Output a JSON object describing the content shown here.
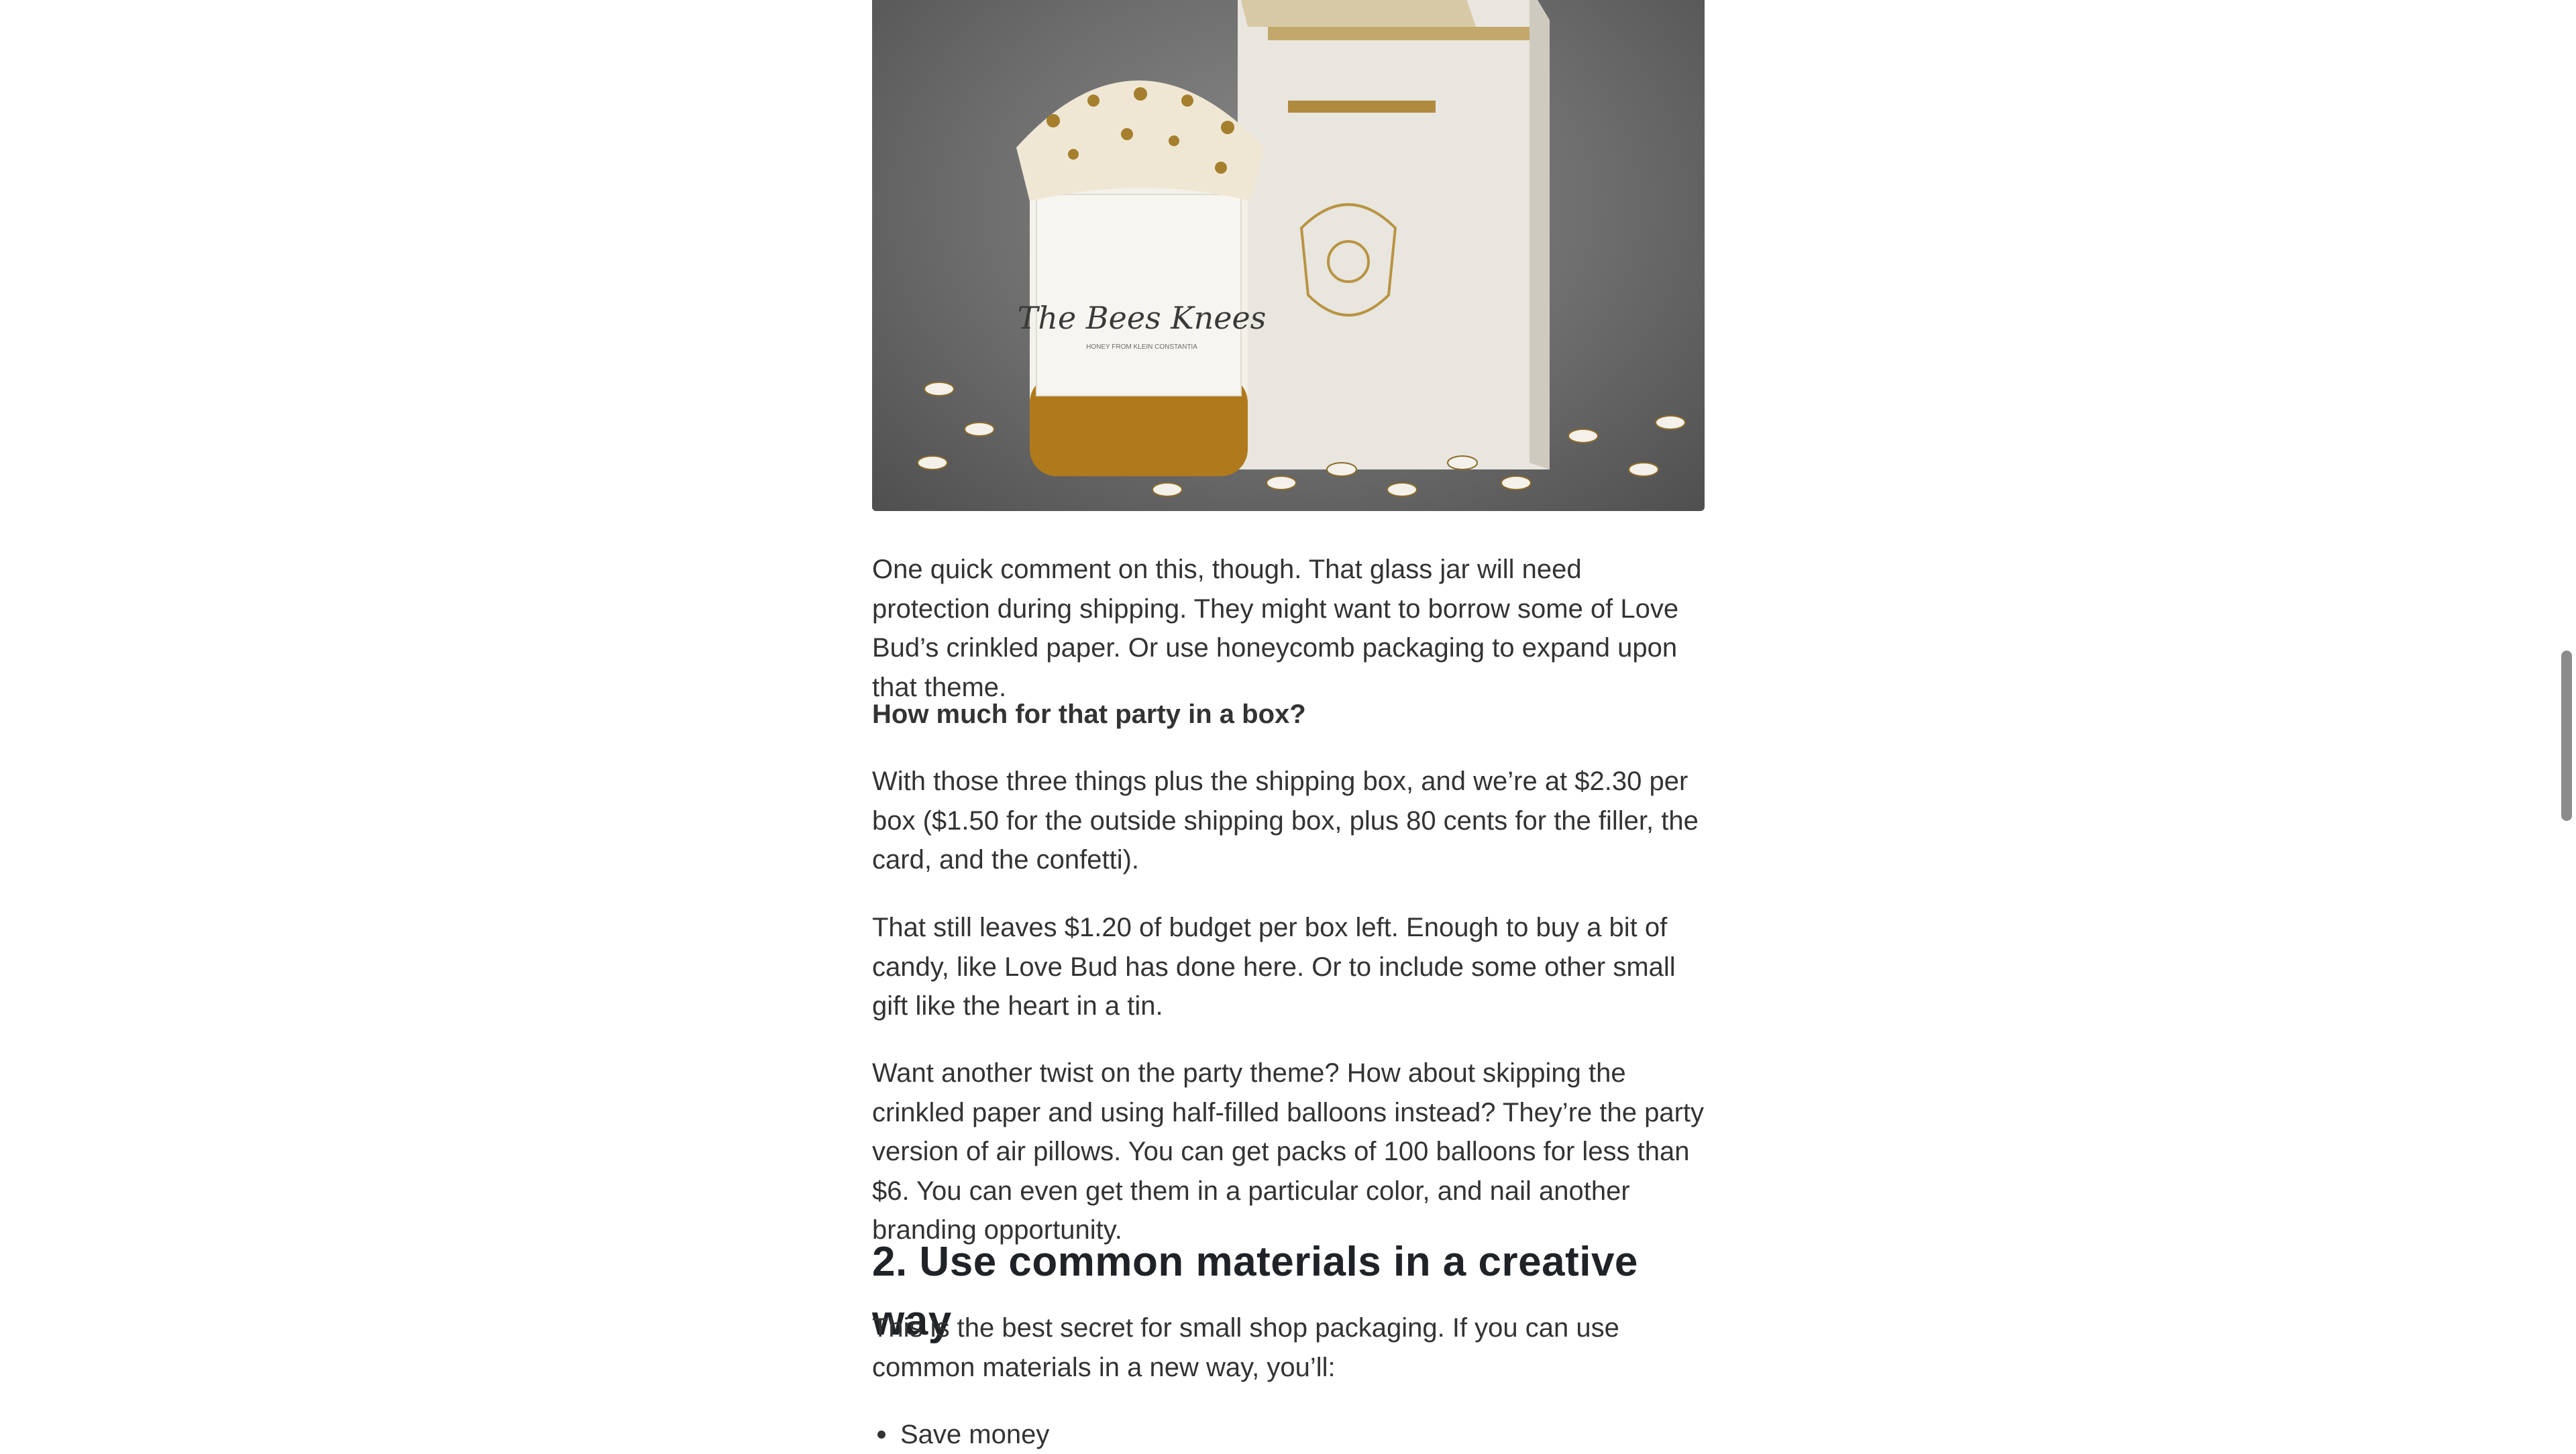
{
  "hero": {
    "jar_label": "The Bees Knees",
    "jar_sublabel": "HONEY FROM KLEIN CONSTANTIA"
  },
  "content": {
    "p1": "One quick comment on this, though. That glass jar will need protection during shipping. They might want to borrow some of Love Bud’s crinkled paper. Or use honeycomb packaging to expand upon that theme.",
    "p2": "How much for that party in a box?",
    "p3": "With those three things plus the shipping box, and we’re at $2.30 per box ($1.50 for the outside shipping box, plus 80 cents for the filler, the card, and the confetti).",
    "p4": "That still leaves $1.20 of budget per box left. Enough to buy a bit of candy, like Love Bud has done here. Or to include some other small gift like the heart in a tin.",
    "p5": "Want another twist on the party theme? How about skipping the crinkled paper and using half-filled balloons instead? They’re the party version of air pillows. You can get packs of 100 balloons for less than $6. You can even get them in a particular color, and nail another branding opportunity.",
    "h2": "2. Use common materials in a creative way",
    "p6": "This is the best secret for small shop packaging. If you can use common materials in a new way, you’ll:",
    "list": [
      "Save money"
    ]
  },
  "colors": {
    "text": "#333333",
    "heading": "#1f2328",
    "scrollbar": "#8c8c8c"
  }
}
